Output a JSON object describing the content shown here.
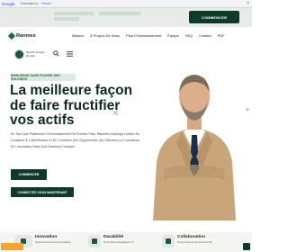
{
  "translate_bar": {
    "google": "Google",
    "translated_by": "Translated to:",
    "language": "French",
    "close": "×"
  },
  "topbar": {
    "start_button": "COMMENCER"
  },
  "header": {
    "logo_text": "Ranmes",
    "nav": [
      "Maison",
      "À Propos De Nous",
      "Plan D'investissement",
      "Équipe",
      "FAQ",
      "Contact",
      "PDF"
    ]
  },
  "hero": {
    "user_name": "Nombre de ligne du texte",
    "badge": "BIENVENUE DANS FICHIER DES HOLDINGS",
    "title": "La meilleure façon de faire fructifier vos actifs",
    "text": "En Tant Que Plateforme D'investissement De Premier Plan, Ranshes Holdings Limited Se Consacre À L'identification D'Et L'entretien Des Opportunités Qui Stimulent La Croissance Et L'innovation Dans Des Secteurs Critiques.",
    "start_button": "COMMENCER",
    "connect_button": "CONNECTEZ-VOUS MAINTENANT"
  },
  "features": [
    {
      "title": "Innovation",
      "sub": "Nous Favorisons L'innovation"
    },
    {
      "title": "Durabilité",
      "sub": "Nous Nous Engageons À"
    },
    {
      "title": "Collaboration",
      "sub": "Nous Croyons Au Pouvoir Du"
    }
  ],
  "colors": {
    "brand_dark": "#0e3a2a",
    "brand_green": "#1b5a3e",
    "accent_light": "#dfe9e2"
  }
}
